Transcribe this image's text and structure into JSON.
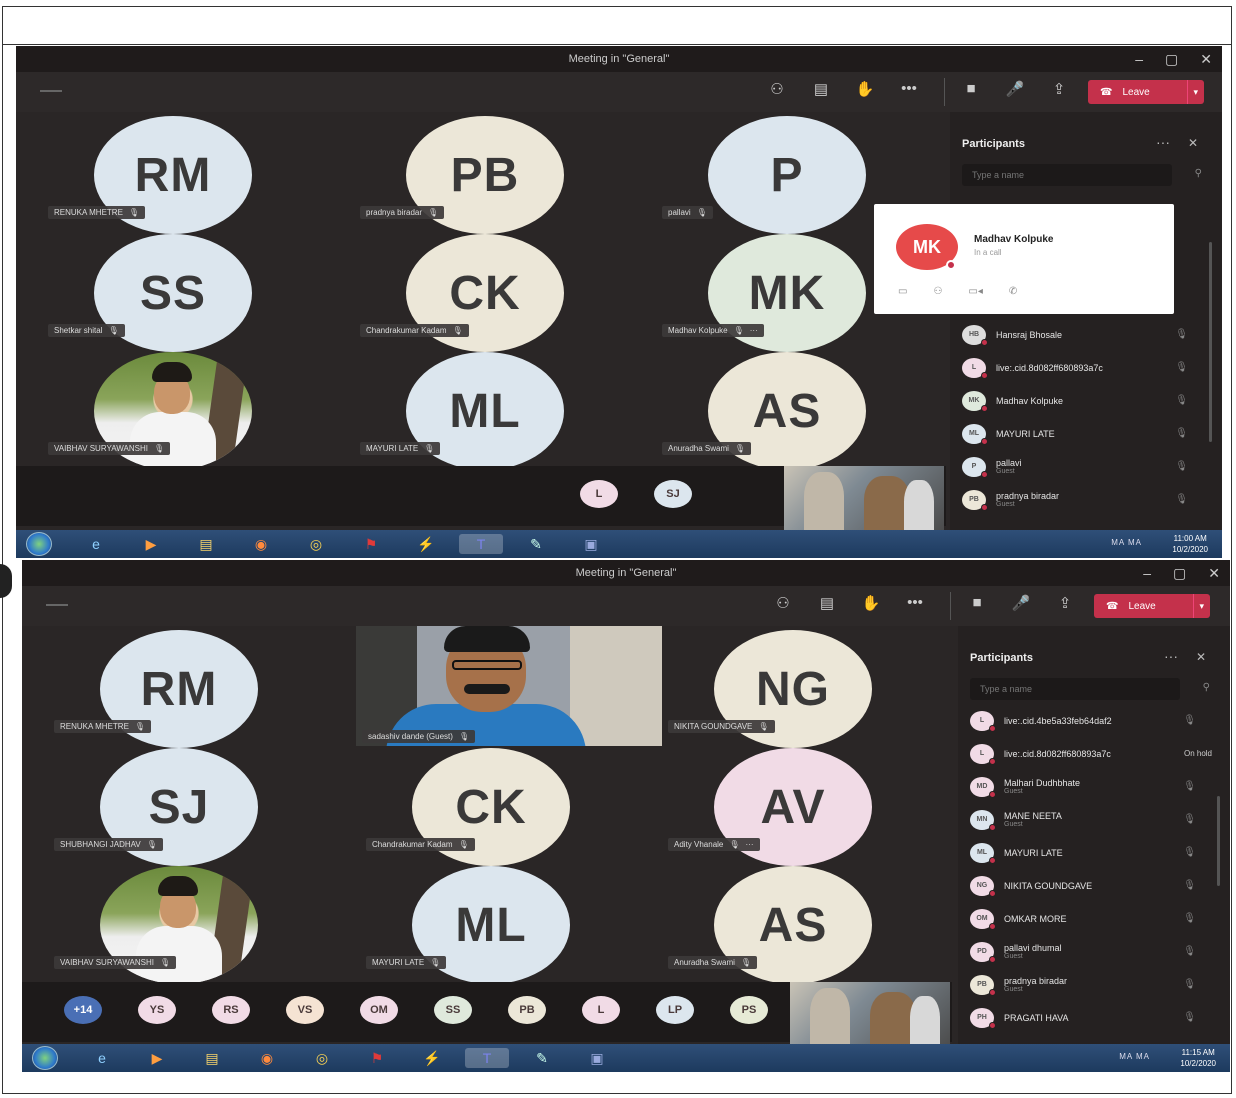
{
  "meeting_title": "Meeting in \"General\"",
  "window_controls": [
    "–",
    "▢",
    "✕"
  ],
  "toolbar": {
    "icons": [
      "participants-icon",
      "chat-icon",
      "raise-hand-icon",
      "more-icon"
    ],
    "icon_glyphs": [
      "⚇",
      "▤",
      "✋",
      "•••"
    ],
    "call_icon_glyphs": [
      "■",
      "🎤",
      "⇪"
    ],
    "leave_label": "Leave"
  },
  "colors": {
    "leave": "#c4314b",
    "background": "#2a2626",
    "panel": "#252121",
    "avatar_light_blue": "#dce6ee",
    "avatar_beige": "#ece7d8",
    "avatar_green": "#dfe9dc",
    "avatar_pink": "#f1dbe6"
  },
  "screen1": {
    "tiles": [
      {
        "initials": "RM",
        "name": "RENUKA MHETRE",
        "color": "#dce6ee"
      },
      {
        "initials": "PB",
        "name": "pradnya biradar",
        "color": "#ece7d8"
      },
      {
        "initials": "P",
        "name": "pallavi",
        "color": "#dce6ee"
      },
      {
        "initials": "SS",
        "name": "Shetkar shital",
        "color": "#dce6ee"
      },
      {
        "initials": "CK",
        "name": "Chandrakumar Kadam",
        "color": "#ece7d8"
      },
      {
        "initials": "MK",
        "name": "Madhav Kolpuke",
        "color": "#dfe9dc"
      },
      {
        "initials": "",
        "name": "VAIBHAV SURYAWANSHI",
        "color": ""
      },
      {
        "initials": "ML",
        "name": "MAYURI LATE",
        "color": "#dce6ee"
      },
      {
        "initials": "AS",
        "name": "Anuradha Swami",
        "color": "#ece7d8"
      }
    ],
    "more_label": "···",
    "strip": [
      {
        "initials": "L",
        "color": "#f1dbe6"
      },
      {
        "initials": "SJ",
        "color": "#dce6ee"
      }
    ],
    "panel": {
      "title": "Participants",
      "more": "···",
      "close": "✕",
      "search_placeholder": "Type a name",
      "participants": [
        {
          "initials": "HB",
          "name": "Hansraj Bhosale",
          "sub": "",
          "color": "#ddd"
        },
        {
          "initials": "L",
          "name": "live:.cid.8d082ff680893a7c",
          "sub": "",
          "color": "#f1dbe6"
        },
        {
          "initials": "MK",
          "name": "Madhav Kolpuke",
          "sub": "",
          "color": "#dfe9dc"
        },
        {
          "initials": "ML",
          "name": "MAYURI LATE",
          "sub": "",
          "color": "#dce6ee"
        },
        {
          "initials": "P",
          "name": "pallavi",
          "sub": "Guest",
          "color": "#dce6ee"
        },
        {
          "initials": "PB",
          "name": "pradnya biradar",
          "sub": "Guest",
          "color": "#ece7d8"
        }
      ]
    },
    "card": {
      "initials": "MK",
      "name": "Madhav Kolpuke",
      "status": "In a call",
      "actions": [
        "▭",
        "⚇",
        "▭◂",
        "✆"
      ]
    },
    "clock": {
      "time": "11:00 AM",
      "date": "10/2/2020"
    },
    "tray_text": "MA MA"
  },
  "screen2": {
    "tiles": [
      {
        "initials": "RM",
        "name": "RENUKA MHETRE",
        "color": "#dce6ee"
      },
      {
        "initials": "",
        "name": "sadashiv dande (Guest)",
        "color": ""
      },
      {
        "initials": "NG",
        "name": "NIKITA GOUNDGAVE",
        "color": "#ece7d8"
      },
      {
        "initials": "SJ",
        "name": "SHUBHANGI JADHAV",
        "color": "#dce6ee"
      },
      {
        "initials": "CK",
        "name": "Chandrakumar Kadam",
        "color": "#ece7d8"
      },
      {
        "initials": "AV",
        "name": "Adity Vhanale",
        "color": "#f1dbe6"
      },
      {
        "initials": "",
        "name": "VAIBHAV SURYAWANSHI",
        "color": ""
      },
      {
        "initials": "ML",
        "name": "MAYURI LATE",
        "color": "#dce6ee"
      },
      {
        "initials": "AS",
        "name": "Anuradha Swami",
        "color": "#ece7d8"
      }
    ],
    "more_label": "···",
    "strip": [
      {
        "initials": "+14",
        "color": "#4a6fb5"
      },
      {
        "initials": "YS",
        "color": "#f1dbe6"
      },
      {
        "initials": "RS",
        "color": "#f1dbe6"
      },
      {
        "initials": "VS",
        "color": "#f5e3d3"
      },
      {
        "initials": "OM",
        "color": "#f1dbe6"
      },
      {
        "initials": "SS",
        "color": "#dfe9dc"
      },
      {
        "initials": "PB",
        "color": "#ece7d8"
      },
      {
        "initials": "L",
        "color": "#f1dbe6"
      },
      {
        "initials": "LP",
        "color": "#dce6ee"
      },
      {
        "initials": "PS",
        "color": "#e6ead6"
      }
    ],
    "panel": {
      "title": "Participants",
      "more": "···",
      "close": "✕",
      "search_placeholder": "Type a name",
      "participants": [
        {
          "initials": "L",
          "name": "live:.cid.4be5a33feb64daf2",
          "sub": "",
          "status": "",
          "color": "#f1dbe6"
        },
        {
          "initials": "L",
          "name": "live:.cid.8d082ff680893a7c",
          "sub": "",
          "status": "On hold",
          "color": "#f1dbe6"
        },
        {
          "initials": "MD",
          "name": "Malhari Dudhbhate",
          "sub": "Guest",
          "status": "",
          "color": "#f1dbe6"
        },
        {
          "initials": "MN",
          "name": "MANE NEETA",
          "sub": "Guest",
          "status": "",
          "color": "#dce6ee"
        },
        {
          "initials": "ML",
          "name": "MAYURI LATE",
          "sub": "",
          "status": "",
          "color": "#dce6ee"
        },
        {
          "initials": "NG",
          "name": "NIKITA GOUNDGAVE",
          "sub": "",
          "status": "",
          "color": "#f1dbe6"
        },
        {
          "initials": "OM",
          "name": "OMKAR MORE",
          "sub": "",
          "status": "",
          "color": "#f1dbe6"
        },
        {
          "initials": "PD",
          "name": "pallavi dhumal",
          "sub": "Guest",
          "status": "",
          "color": "#f1dbe6"
        },
        {
          "initials": "PB",
          "name": "pradnya biradar",
          "sub": "Guest",
          "status": "",
          "color": "#ece7d8"
        },
        {
          "initials": "PH",
          "name": "PRAGATI HAVA",
          "sub": "",
          "status": "",
          "color": "#f1dbe6"
        }
      ]
    },
    "clock": {
      "time": "11:15 AM",
      "date": "10/2/2020"
    },
    "tray_text": "MA MA"
  },
  "taskbar_apps": [
    {
      "icon": "internet-explorer-icon",
      "glyph": "e"
    },
    {
      "icon": "media-player-icon",
      "glyph": "▶"
    },
    {
      "icon": "file-explorer-icon",
      "glyph": "▤"
    },
    {
      "icon": "firefox-icon",
      "glyph": "◉"
    },
    {
      "icon": "chrome-icon",
      "glyph": "◎"
    },
    {
      "icon": "pdf-icon",
      "glyph": "⚑"
    },
    {
      "icon": "tool-icon",
      "glyph": "⚡"
    },
    {
      "icon": "teams-icon",
      "glyph": "T"
    },
    {
      "icon": "paint-icon",
      "glyph": "✎"
    },
    {
      "icon": "window-icon",
      "glyph": "▣"
    }
  ]
}
